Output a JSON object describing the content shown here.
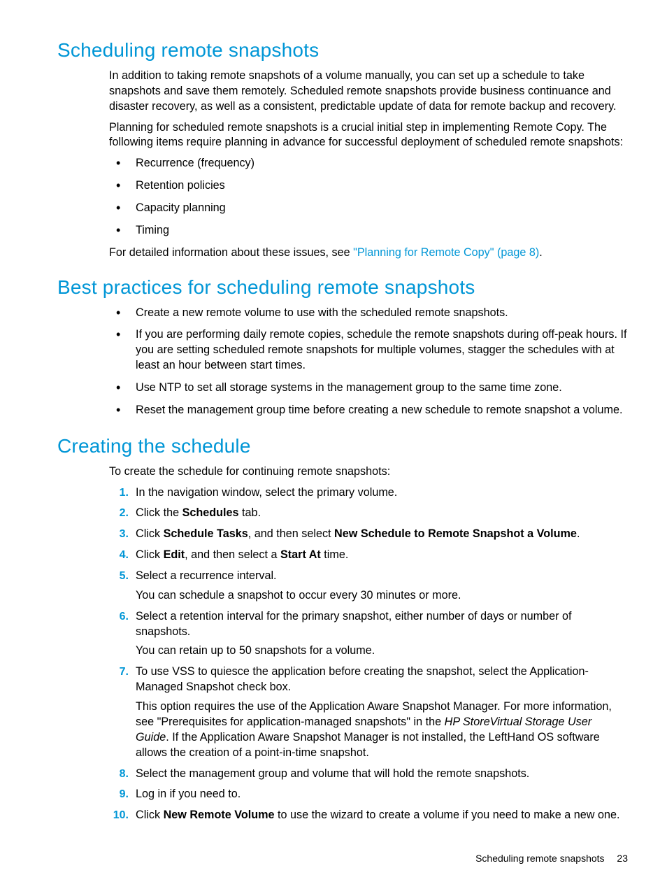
{
  "section1": {
    "heading": "Scheduling remote snapshots",
    "p1": "In addition to taking remote snapshots of a volume manually, you can set up a schedule to take snapshots and save them remotely. Scheduled remote snapshots provide business continuance and disaster recovery, as well as a consistent, predictable update of data for remote backup and recovery.",
    "p2": "Planning for scheduled remote snapshots is a crucial initial step in implementing Remote Copy. The following items require planning in advance for successful deployment of scheduled remote snapshots:",
    "bullets": [
      "Recurrence (frequency)",
      "Retention policies",
      "Capacity planning",
      "Timing"
    ],
    "p3_pre": "For detailed information about these issues, see ",
    "p3_link": "\"Planning for Remote Copy\" (page 8)",
    "p3_post": "."
  },
  "section2": {
    "heading": "Best practices for scheduling remote snapshots",
    "bullets": [
      "Create a new remote volume to use with the scheduled remote snapshots.",
      "If you are performing daily remote copies, schedule the remote snapshots during off-peak hours. If you are setting scheduled remote snapshots for multiple volumes, stagger the schedules with at least an hour between start times.",
      "Use NTP to set all storage systems in the management group to the same time zone.",
      "Reset the management group time before creating a new schedule to remote snapshot a volume."
    ]
  },
  "section3": {
    "heading": "Creating the schedule",
    "intro": "To create the schedule for continuing remote snapshots:",
    "steps": {
      "s1": {
        "num": "1.",
        "text": "In the navigation window, select the primary volume."
      },
      "s2": {
        "num": "2.",
        "pre": "Click the ",
        "b1": "Schedules",
        "post": " tab."
      },
      "s3": {
        "num": "3.",
        "pre": "Click ",
        "b1": "Schedule Tasks",
        "mid": ", and then select ",
        "b2": "New Schedule to Remote Snapshot a Volume",
        "post": "."
      },
      "s4": {
        "num": "4.",
        "pre": "Click ",
        "b1": "Edit",
        "mid": ", and then select a ",
        "b2": "Start At",
        "post": " time."
      },
      "s5": {
        "num": "5.",
        "text": "Select a recurrence interval.",
        "sub": "You can schedule a snapshot to occur every 30 minutes or more."
      },
      "s6": {
        "num": "6.",
        "text": "Select a retention interval for the primary snapshot, either number of days or number of snapshots.",
        "sub": "You can retain up to 50 snapshots for a volume."
      },
      "s7": {
        "num": "7.",
        "text": "To use VSS to quiesce the application before creating the snapshot, select the Application-Managed Snapshot check box.",
        "sub_pre": "This option requires the use of the Application Aware Snapshot Manager. For more information, see \"Prerequisites for application-managed snapshots\" in the ",
        "sub_i": "HP StoreVirtual Storage User Guide",
        "sub_post": ". If the Application Aware Snapshot Manager is not installed, the LeftHand OS software allows the creation of a point-in-time snapshot."
      },
      "s8": {
        "num": "8.",
        "text": "Select the management group and volume that will hold the remote snapshots."
      },
      "s9": {
        "num": "9.",
        "text": "Log in if you need to."
      },
      "s10": {
        "num": "10.",
        "pre": "Click ",
        "b1": "New Remote Volume",
        "post": " to use the wizard to create a volume if you need to make a new one."
      }
    }
  },
  "footer": {
    "title": "Scheduling remote snapshots",
    "page": "23"
  }
}
